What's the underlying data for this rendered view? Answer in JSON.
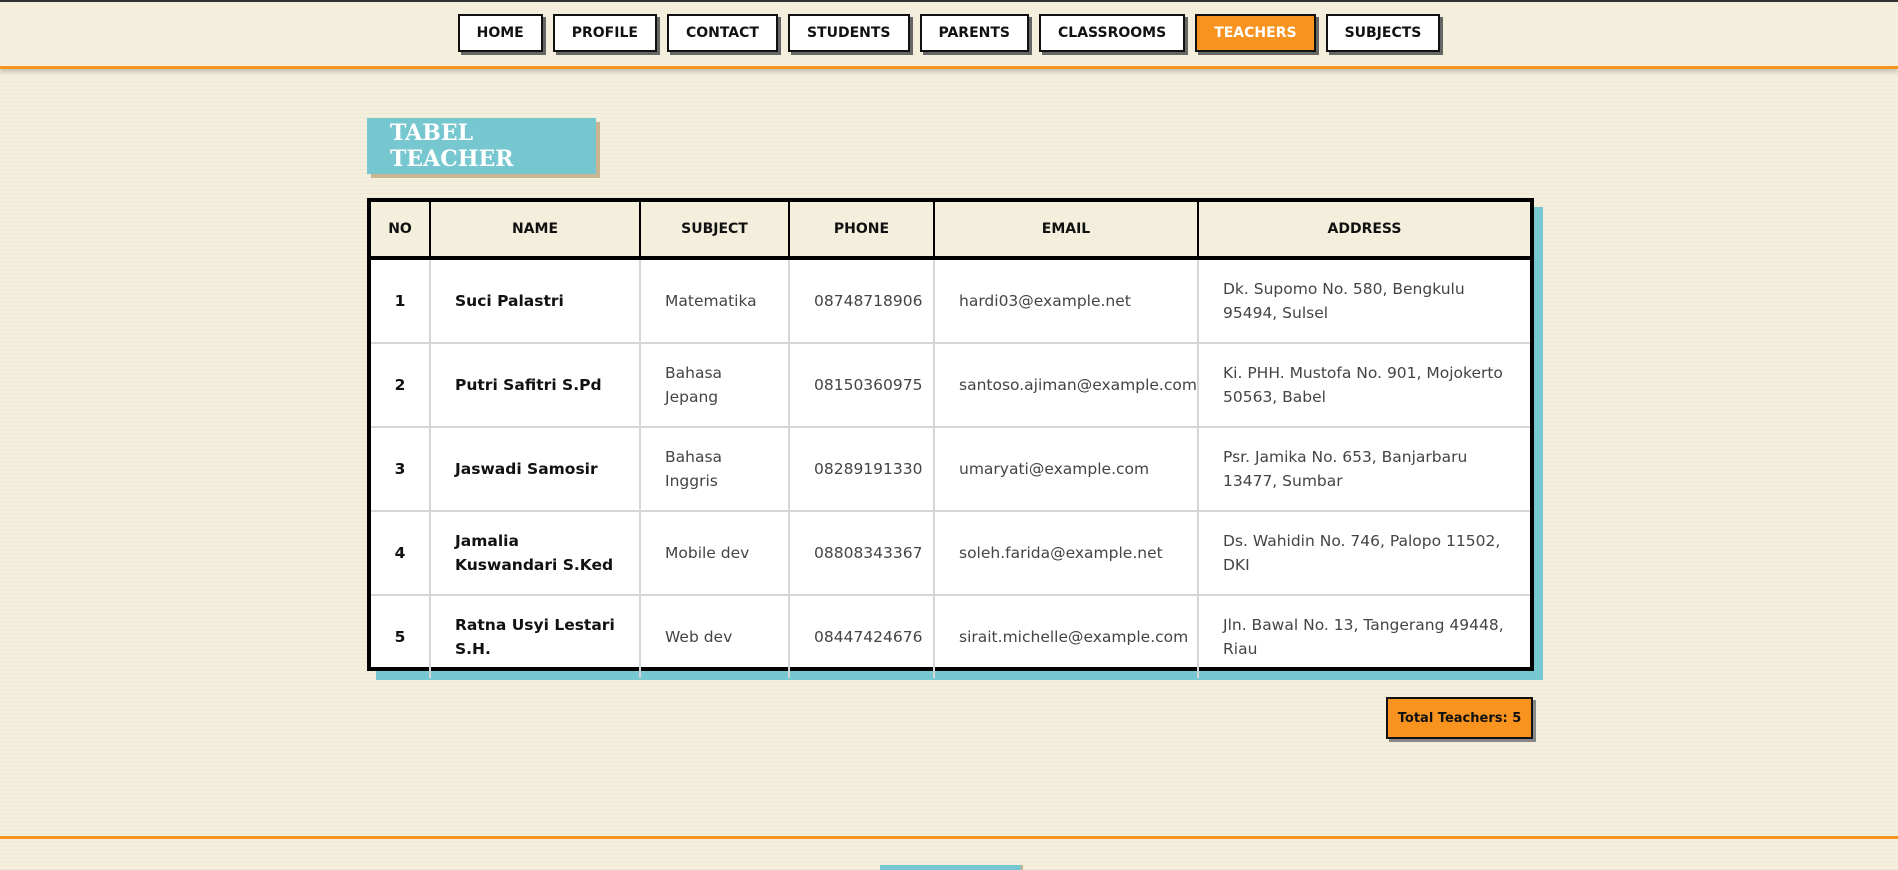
{
  "nav": {
    "items": [
      {
        "label": "HOME",
        "active": false
      },
      {
        "label": "PROFILE",
        "active": false
      },
      {
        "label": "CONTACT",
        "active": false
      },
      {
        "label": "STUDENTS",
        "active": false
      },
      {
        "label": "PARENTS",
        "active": false
      },
      {
        "label": "CLASSROOMS",
        "active": false
      },
      {
        "label": "TEACHERS",
        "active": true
      },
      {
        "label": "SUBJECTS",
        "active": false
      }
    ]
  },
  "page_title": "TABEL TEACHER",
  "table": {
    "headers": [
      "NO",
      "NAME",
      "SUBJECT",
      "PHONE",
      "EMAIL",
      "ADDRESS"
    ],
    "rows": [
      {
        "no": "1",
        "name": "Suci Palastri",
        "subject": "Matematika",
        "phone": "08748718906",
        "email": "hardi03@example.net",
        "address": "Dk. Supomo No. 580, Bengkulu 95494, Sulsel"
      },
      {
        "no": "2",
        "name": "Putri Safitri S.Pd",
        "subject": "Bahasa Jepang",
        "phone": "08150360975",
        "email": "santoso.ajiman@example.com",
        "address": "Ki. PHH. Mustofa No. 901, Mojokerto 50563, Babel"
      },
      {
        "no": "3",
        "name": "Jaswadi Samosir",
        "subject": "Bahasa Inggris",
        "phone": "08289191330",
        "email": "umaryati@example.com",
        "address": "Psr. Jamika No. 653, Banjarbaru 13477, Sumbar"
      },
      {
        "no": "4",
        "name": "Jamalia Kuswandari S.Ked",
        "subject": "Mobile dev",
        "phone": "08808343367",
        "email": "soleh.farida@example.net",
        "address": "Ds. Wahidin No. 746, Palopo 11502, DKI"
      },
      {
        "no": "5",
        "name": "Ratna Usyi Lestari S.H.",
        "subject": "Web dev",
        "phone": "08447424676",
        "email": "sirait.michelle@example.com",
        "address": "Jln. Bawal No. 13, Tangerang 49448, Riau"
      }
    ]
  },
  "total_label": "Total Teachers: 5",
  "colors": {
    "accent": "#f7931e",
    "teal": "#76c7d0",
    "background": "#f4eedc"
  }
}
